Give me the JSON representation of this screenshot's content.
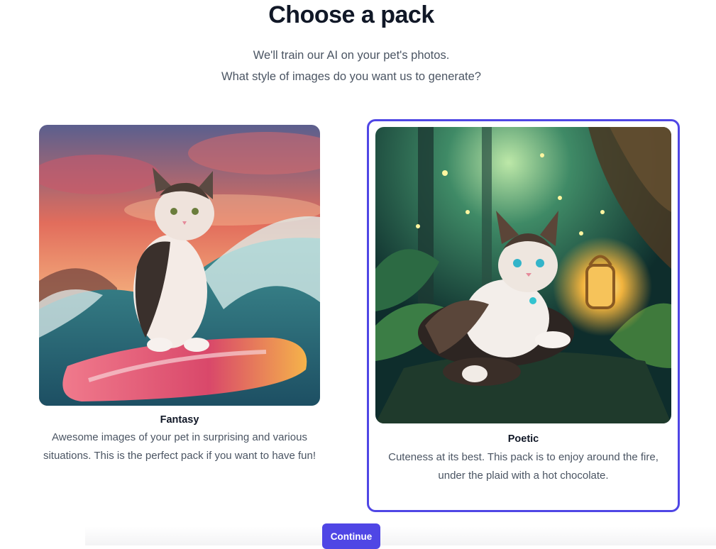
{
  "page": {
    "title": "Choose a pack",
    "subtitle_line1": "We'll train our AI on your pet's photos.",
    "subtitle_line2": "What style of images do you want us to generate?"
  },
  "packs": [
    {
      "name": "Fantasy",
      "description": "Awesome images of your pet in surprising and various situations. This is the perfect pack if you want to have fun!",
      "image": "cat-on-surfboard-image",
      "selected": false
    },
    {
      "name": "Poetic",
      "description": "Cuteness at its best. This pack is to enjoy around the fire, under the plaid with a hot chocolate.",
      "image": "cat-with-lantern-in-forest-image",
      "selected": true
    }
  ],
  "actions": {
    "continue_label": "Continue"
  },
  "colors": {
    "accent": "#4f46e5",
    "title": "#111827",
    "text": "#4b5563"
  }
}
